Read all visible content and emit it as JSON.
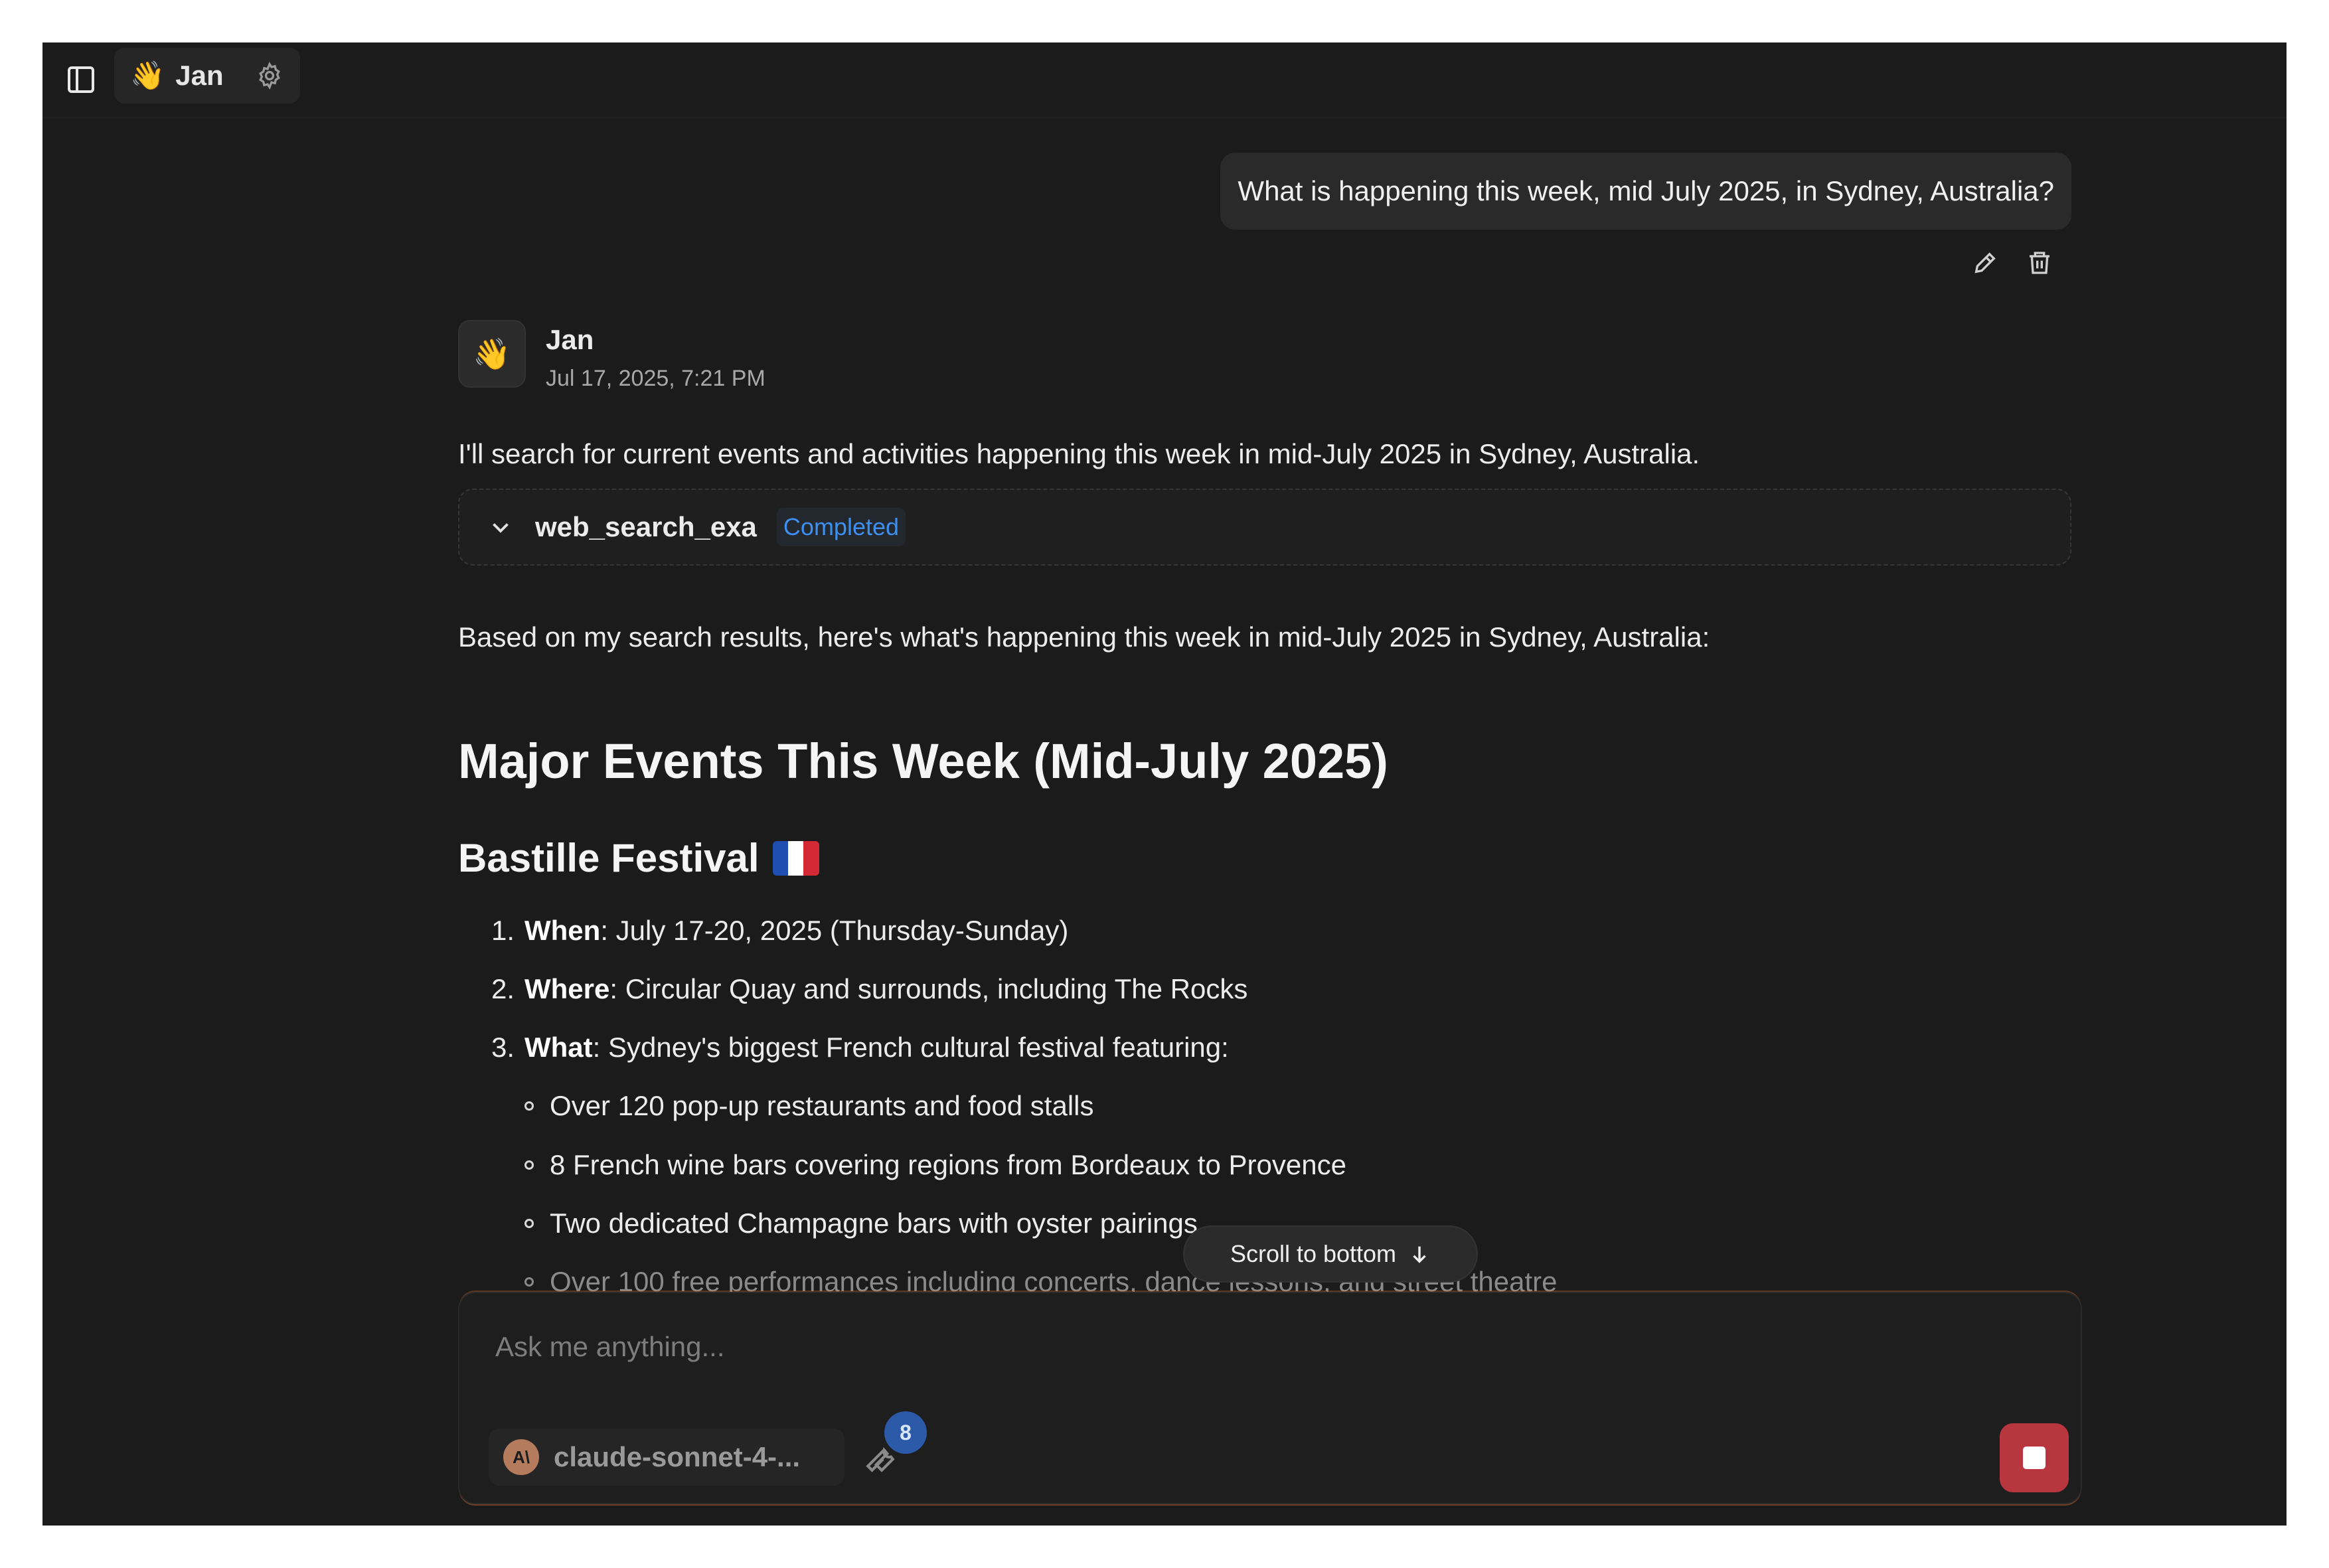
{
  "agent": {
    "emoji": "👋",
    "name": "Jan"
  },
  "user_message": "What is happening this week, mid July 2025, in Sydney, Australia?",
  "assistant": {
    "avatar_emoji": "👋",
    "name": "Jan",
    "timestamp": "Jul 17, 2025, 7:21 PM",
    "intro": "I'll search for current events and activities happening this week in mid-July 2025 in Sydney, Australia.",
    "tool_call": {
      "name": "web_search_exa",
      "status": "Completed",
      "status_color": "#3d8ff0"
    },
    "summary": "Based on my search results, here's what's happening this week in mid-July 2025 in Sydney, Australia:",
    "heading": "Major Events This Week (Mid-July 2025)",
    "subheading": "Bastille Festival",
    "flag_colors": [
      "#1f4fb0",
      "#ffffff",
      "#d42a36"
    ],
    "list": [
      {
        "num": "1.",
        "label": "When",
        "text": ": July 17-20, 2025 (Thursday-Sunday)"
      },
      {
        "num": "2.",
        "label": "Where",
        "text": ": Circular Quay and surrounds, including The Rocks"
      },
      {
        "num": "3.",
        "label": "What",
        "text": ": Sydney's biggest French cultural festival featuring:"
      }
    ],
    "bullets": [
      "Over 120 pop-up restaurants and food stalls",
      "8 French wine bars covering regions from Bordeaux to Provence",
      "Two dedicated Champagne bars with oyster pairings",
      "Over 100 free performances including concerts, dance lessons, and street theatre"
    ]
  },
  "scroll_to_bottom": "Scroll to bottom",
  "composer": {
    "placeholder": "Ask me anything...",
    "model": "claude-sonnet-4-...",
    "model_logo": "A\\",
    "tools_count": "8",
    "stop_color": "#b8363e"
  },
  "icons": {
    "sidebar": "sidebar-toggle-icon",
    "gear": "gear-icon",
    "edit": "pencil-icon",
    "delete": "trash-icon",
    "chevron": "chevron-down-icon",
    "arrow": "arrow-down-icon",
    "tools": "wrench-icon",
    "stop": "stop-icon"
  }
}
